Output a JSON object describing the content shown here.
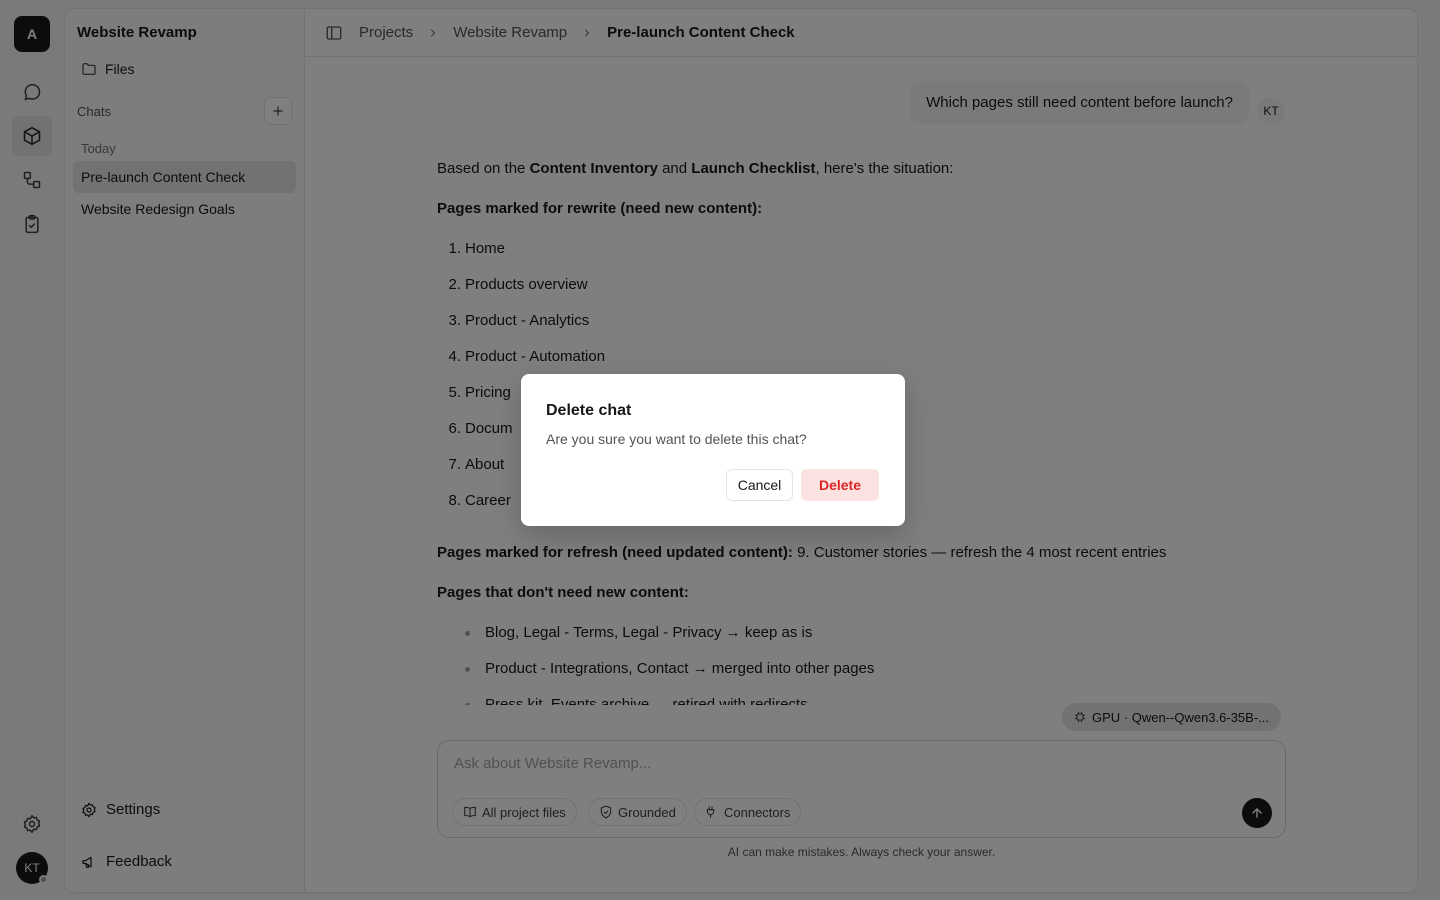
{
  "rail": {
    "logo": "A",
    "avatar": "KT",
    "items": [
      "chat-icon",
      "box-icon",
      "workflow-icon",
      "clipboard-check-icon",
      "gear-icon"
    ]
  },
  "sidebar": {
    "project_title": "Website Revamp",
    "files_label": "Files",
    "chats_label": "Chats",
    "today_label": "Today",
    "chats": [
      {
        "title": "Pre-launch Content Check",
        "active": true
      },
      {
        "title": "Website Redesign Goals",
        "active": false
      }
    ],
    "settings_label": "Settings",
    "feedback_label": "Feedback"
  },
  "breadcrumb": [
    "Projects",
    "Website Revamp",
    "Pre-launch Content Check"
  ],
  "conversation": {
    "user_message": "Which pages still need content before launch?",
    "user_initials": "KT",
    "intro_pre": "Based on the ",
    "intro_doc1": "Content Inventory",
    "intro_and": " and ",
    "intro_doc2": "Launch Checklist",
    "intro_post": ", here's the situation:",
    "rewrite_heading": "Pages marked for rewrite (need new content):",
    "rewrite_pages": [
      {
        "num": "1.",
        "label": "Home"
      },
      {
        "num": "2.",
        "label": "Products overview"
      },
      {
        "num": "3.",
        "label": "Product - Analytics"
      },
      {
        "num": "4.",
        "label": "Product - Automation"
      },
      {
        "num": "5.",
        "label": "Pricing"
      },
      {
        "num": "6.",
        "label": "Docum"
      },
      {
        "num": "7.",
        "label": "About"
      },
      {
        "num": "8.",
        "label": "Career"
      }
    ],
    "refresh_heading": "Pages marked for refresh (need updated content):",
    "refresh_text": " 9. Customer stories — refresh the 4 most recent entries",
    "no_content_heading": "Pages that don't need new content:",
    "no_content_items": [
      "Blog, Legal - Terms, Legal - Privacy → keep as is",
      "Product - Integrations, Contact → merged into other pages",
      "Press kit, Events archive → retired with redirects"
    ]
  },
  "model_chip": "GPU · Qwen--Qwen3.6-35B-...",
  "composer": {
    "placeholder": "Ask about Website Revamp...",
    "pills": [
      "All project files",
      "Grounded",
      "Connectors"
    ]
  },
  "disclaimer": "AI can make mistakes. Always check your answer.",
  "dialog": {
    "title": "Delete chat",
    "message": "Are you sure you want to delete this chat?",
    "cancel_label": "Cancel",
    "delete_label": "Delete"
  },
  "colors": {
    "accent_dark": "#18181b",
    "danger": "#dc2626",
    "danger_bg": "#fde2e2"
  }
}
